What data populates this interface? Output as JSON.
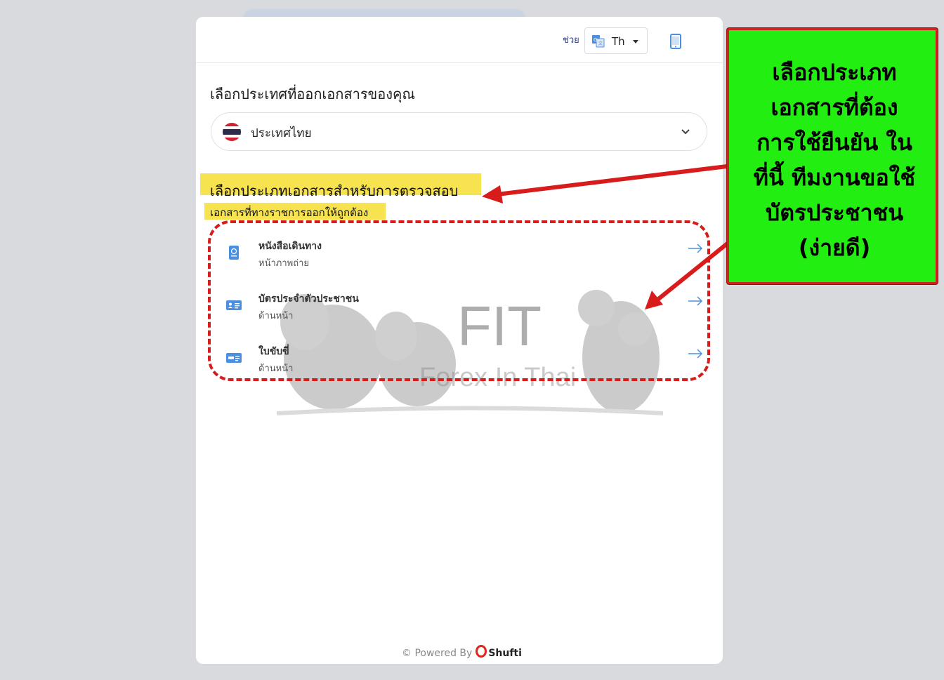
{
  "top_bar": {
    "help_label": "ช่วย",
    "language": {
      "label": "Th",
      "icon": "translate-icon"
    },
    "device_icon": "mobile-phone-icon"
  },
  "country_section": {
    "title": "เลือกประเทศที่ออกเอกสารของคุณ",
    "selected_country": "ประเทศไทย",
    "flag_icon": "thailand-flag-icon"
  },
  "document_section": {
    "title": "เลือกประเภทเอกสารสำหรับการตรวจสอบ",
    "subtitle": "เอกสารที่ทางราชการออกให้ถูกต้อง",
    "items": [
      {
        "name": "หนังสือเดินทาง",
        "description": "หน้าภาพถ่าย",
        "icon": "passport-icon"
      },
      {
        "name": "บัตรประจำตัวประชาชน",
        "description": "ด้านหน้า",
        "icon": "id-card-icon"
      },
      {
        "name": "ใบขับขี่",
        "description": "ด้านหน้า",
        "icon": "driver-license-icon"
      }
    ]
  },
  "watermark": {
    "title": "FIT",
    "subtitle": "Forex In Thai"
  },
  "footer": {
    "powered_by": "© Powered By",
    "brand": "Shufti"
  },
  "annotation": {
    "lines": [
      "เลือกประเภท",
      "เอกสารที่ต้อง",
      "การใช้ยืนยัน ใน",
      "ที่นี้ ทีมงานขอใช้",
      "บัตรประชาชน",
      "(ง่ายดี)"
    ]
  },
  "colors": {
    "accent_blue": "#4a90e2",
    "highlight_yellow": "#f7e34f",
    "annotation_red": "#d81c1c",
    "callout_green": "#22ee11",
    "brand_red": "#e2231a"
  }
}
